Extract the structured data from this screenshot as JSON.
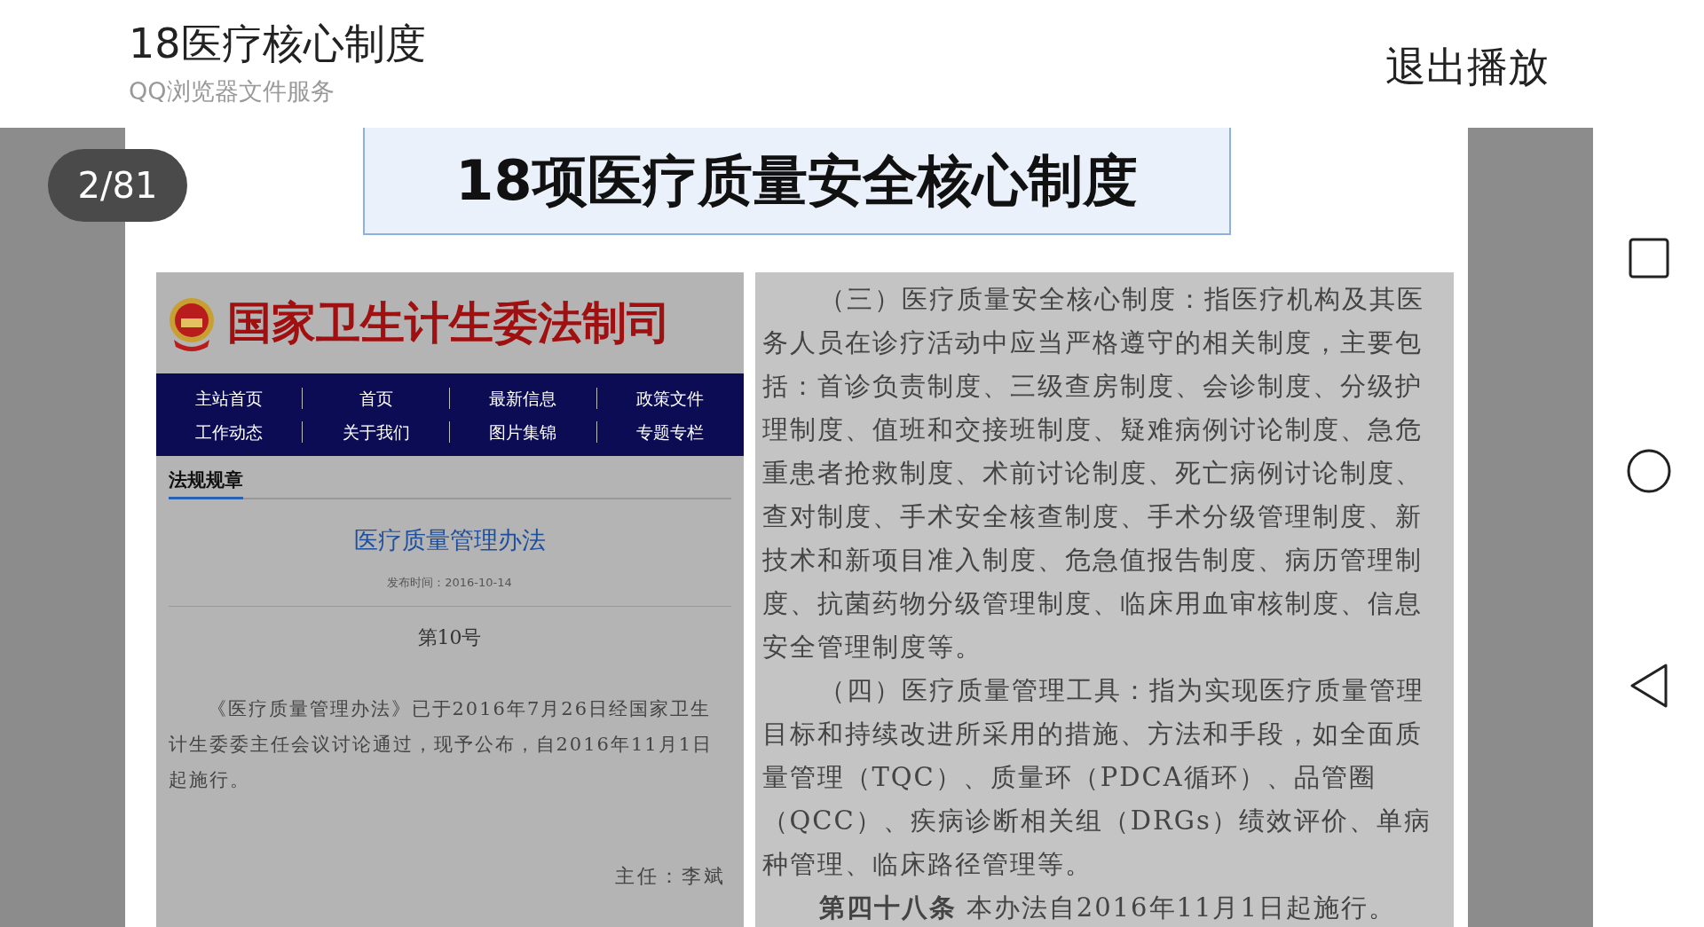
{
  "header": {
    "title": "18医疗核心制度",
    "subtitle": "QQ浏览器文件服务",
    "exit_button": "退出播放"
  },
  "page_indicator": "2/81",
  "slide": {
    "title": "18项医疗质量安全核心制度",
    "left_panel": {
      "site_title": "国家卫生计生委法制司",
      "nav_items": [
        {
          "label": "主站首页"
        },
        {
          "label": "首页"
        },
        {
          "label": "最新信息"
        },
        {
          "label": "政策文件"
        },
        {
          "label": "工作动态"
        },
        {
          "label": "关于我们"
        },
        {
          "label": "图片集锦"
        },
        {
          "label": "专题专栏"
        }
      ],
      "section_tab": "法规规章",
      "article_title": "医疗质量管理办法",
      "publish_date": "发布时间：2016-10-14",
      "doc_number": "第10号",
      "body": "《医疗质量管理办法》已于2016年7月26日经国家卫生计生委委主任会议讨论通过，现予公布，自2016年11月1日起施行。",
      "signature": "主任：李斌"
    },
    "right_panel": {
      "paragraphs": [
        "（三）医疗质量安全核心制度：指医疗机构及其医务人员在诊疗活动中应当严格遵守的相关制度，主要包括：首诊负责制度、三级查房制度、会诊制度、分级护理制度、值班和交接班制度、疑难病例讨论制度、急危重患者抢救制度、术前讨论制度、死亡病例讨论制度、查对制度、手术安全核查制度、手术分级管理制度、新技术和新项目准入制度、危急值报告制度、病历管理制度、抗菌药物分级管理制度、临床用血审核制度、信息安全管理制度等。",
        "（四）医疗质量管理工具：指为实现医疗质量管理目标和持续改进所采用的措施、方法和手段，如全面质量管理（TQC）、质量环（PDCA循环）、品管圈（QCC）、疾病诊断相关组（DRGs）绩效评价、单病种管理、临床路径管理等。",
        "**第四十八条** 本办法自2016年11月1日起施行。"
      ]
    }
  }
}
